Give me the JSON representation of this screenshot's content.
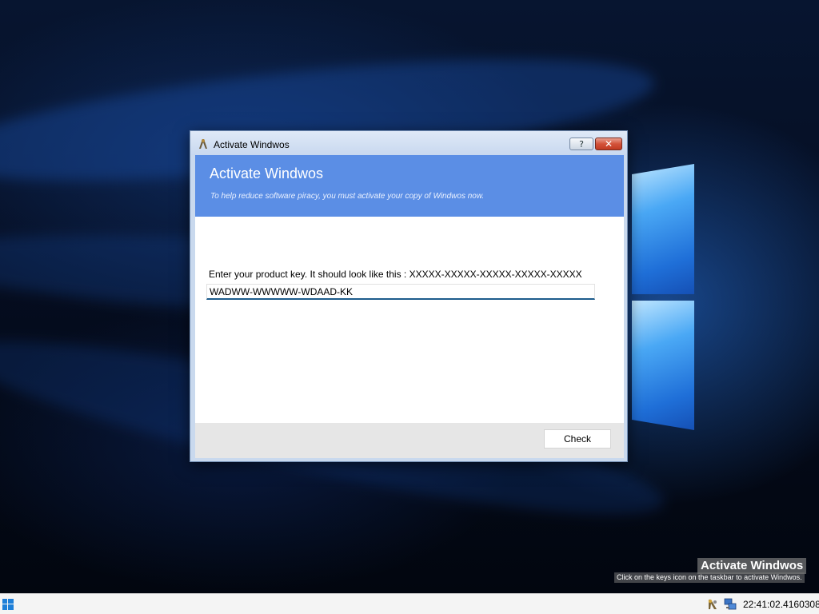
{
  "dialog": {
    "title": "Activate Windwos",
    "help_label": "?",
    "close_label": "✕",
    "header_title": "Activate Windwos",
    "header_subtitle": "To help reduce software piracy, you must activate your copy of Windwos now.",
    "prompt": "Enter your product key. It should look like this : XXXXX-XXXXX-XXXXX-XXXXX-XXXXX",
    "product_key_value": "WADWW-WWWWW-WDAAD-KK",
    "check_label": "Check"
  },
  "watermark": {
    "title": "Activate Windwos",
    "subtitle": "Click on the keys icon on the taskbar to activate Windwos."
  },
  "taskbar": {
    "clock": "22:41:02.4160308",
    "tray_icons": [
      "keys-icon",
      "network-icon"
    ],
    "start_icon": "windows-logo-icon"
  },
  "colors": {
    "header": "#5b8ee5",
    "close_button": "#c9432b",
    "input_underline": "#1d5c8c"
  }
}
